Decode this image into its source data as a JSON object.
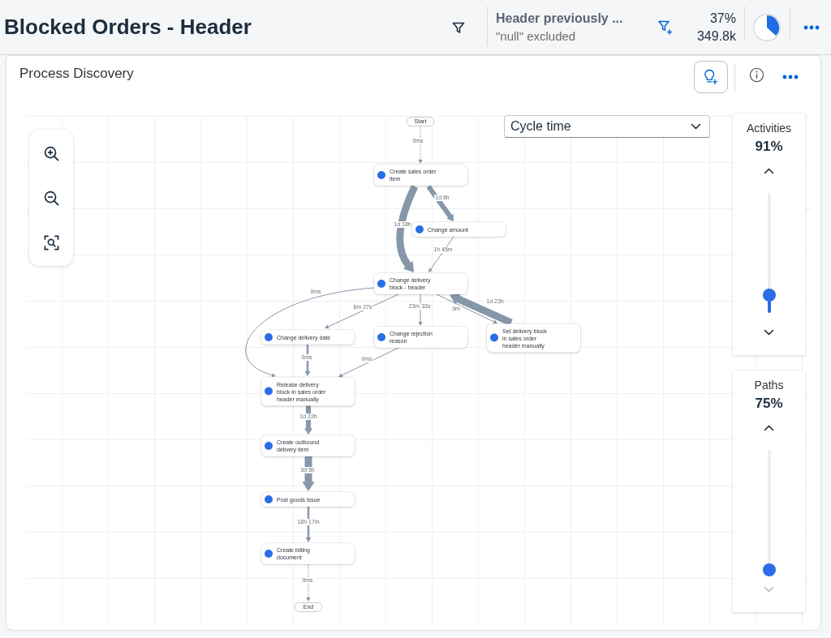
{
  "header": {
    "title": "Blocked Orders - Header",
    "filter": {
      "title": "Header previously ...",
      "subtitle": "\"null\" excluded"
    },
    "stats": {
      "share": "37%",
      "count": "349.8k"
    }
  },
  "card": {
    "title": "Process Discovery",
    "measure": {
      "value": "Cycle time"
    },
    "nodes": [
      {
        "kind": "start",
        "label": "Start"
      },
      {
        "kind": "activity",
        "label": "Create sales order item"
      },
      {
        "kind": "activity",
        "label": "Change amount"
      },
      {
        "kind": "activity",
        "label": "Change delivery block - header"
      },
      {
        "kind": "activity",
        "label": "Change delivery date"
      },
      {
        "kind": "activity",
        "label": "Change rejection reason"
      },
      {
        "kind": "activity",
        "label": "Set delivery block in sales order header manually"
      },
      {
        "kind": "activity",
        "label": "Release delivery block in sales order header manually"
      },
      {
        "kind": "activity",
        "label": "Create outbound delivery item"
      },
      {
        "kind": "activity",
        "label": "Post goods issue"
      },
      {
        "kind": "activity",
        "label": "Create billing document"
      },
      {
        "kind": "end",
        "label": "End"
      }
    ],
    "edges": [
      {
        "label": "0ms",
        "kind": "dotted"
      },
      {
        "label": "1d 8h",
        "kind": "thick"
      },
      {
        "label": "1d 18h",
        "kind": "heavy"
      },
      {
        "label": "1h 45m",
        "kind": "thin"
      },
      {
        "label": "0ms",
        "kind": "thin"
      },
      {
        "label": "6m 27s",
        "kind": "thin"
      },
      {
        "label": "23m 33s",
        "kind": "thin"
      },
      {
        "label": "0m",
        "kind": "thin"
      },
      {
        "label": "1d 23h",
        "kind": "heavy"
      },
      {
        "label": "0ms",
        "kind": "medium"
      },
      {
        "label": "0ms",
        "kind": "thin"
      },
      {
        "label": "1d 22h",
        "kind": "thick"
      },
      {
        "label": "3d 5h",
        "kind": "heavy"
      },
      {
        "label": "18h 17m",
        "kind": "medium"
      },
      {
        "label": "0ms",
        "kind": "dotted"
      }
    ],
    "sliders": [
      {
        "label": "Activities",
        "value": "91%",
        "level": 0.15,
        "down_disabled": false
      },
      {
        "label": "Paths",
        "value": "75%",
        "level": 0,
        "down_disabled": true
      }
    ]
  }
}
